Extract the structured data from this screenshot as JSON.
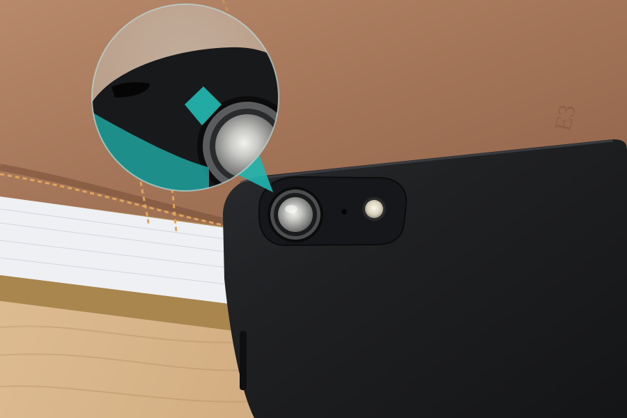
{
  "scene": {
    "kind": "product-photo",
    "subject": "black-phone-case-camera-cutout",
    "embossed_mark": "E3",
    "colors": {
      "wood": "#d9b98c",
      "leather": "#a6775a",
      "stitch": "#e0a55b",
      "page_edge": "#eef0f4",
      "gold_edge": "#b3925a",
      "case": "#1e1f21",
      "accent_teal": "#1fb6b0"
    },
    "icons": {
      "lens": "camera-lens",
      "flash": "flash-led",
      "mic": "microphone-hole"
    }
  }
}
